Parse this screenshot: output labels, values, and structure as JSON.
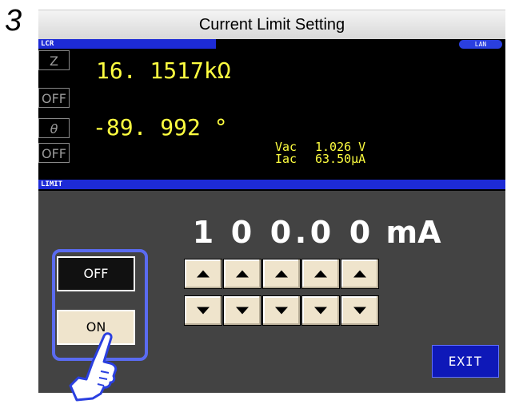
{
  "step_number": "3",
  "title": "Current Limit Setting",
  "screen": {
    "top_header_label": "LCR",
    "lan_label": "LAN",
    "params": [
      {
        "label": "Z",
        "state": "OFF",
        "value": "16. 1517kΩ"
      },
      {
        "label": "θ",
        "state": "OFF",
        "value": "-89. 992 °"
      }
    ],
    "monitor": {
      "vac_label": "Vac",
      "vac_value": "1.026 V",
      "iac_label": "Iac",
      "iac_value": "63.50μA"
    },
    "limit_header_label": "LIMIT",
    "limit_digits": [
      "1",
      "0",
      "0",
      "0",
      "0"
    ],
    "decimal_point": ".",
    "unit": "mA",
    "toggle": {
      "off_label": "OFF",
      "on_label": "ON",
      "selected": "OFF"
    },
    "exit_label": "EXIT"
  },
  "icons": {
    "up": "triangle-up-icon",
    "down": "triangle-down-icon",
    "hand": "pointing-hand-icon"
  },
  "colors": {
    "accent_blue": "#1d2bd6",
    "value_yellow": "#ffff40",
    "button_beige": "#efe4cc",
    "highlight_frame": "#5a6bf0"
  }
}
